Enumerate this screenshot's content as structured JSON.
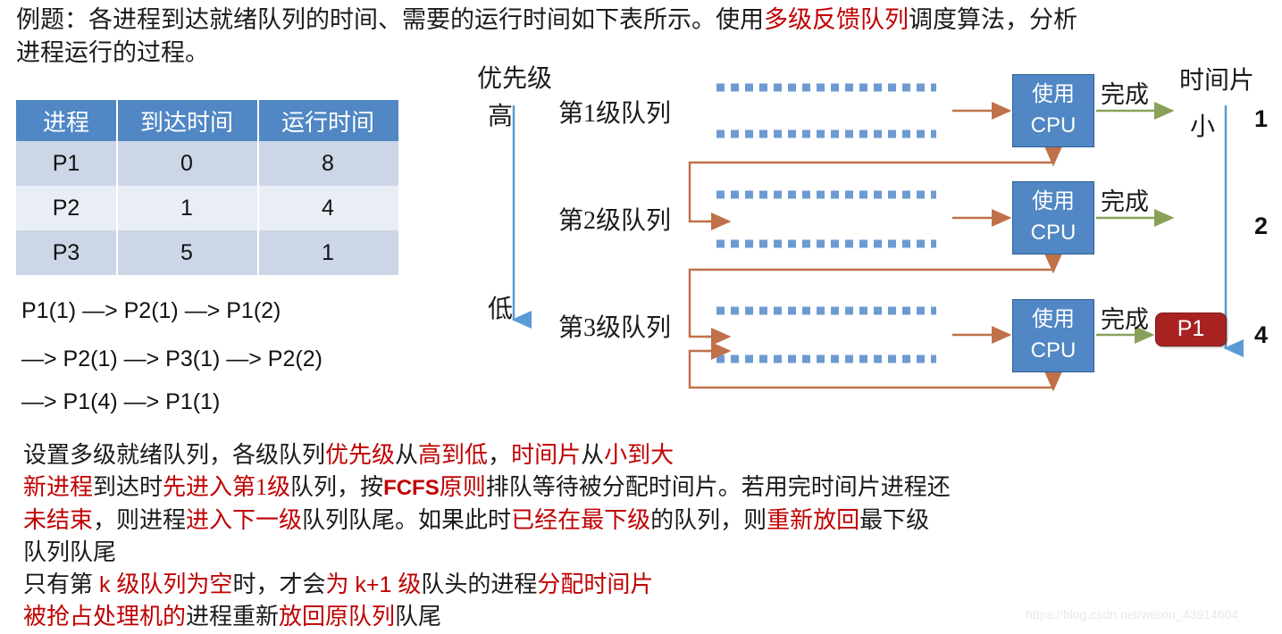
{
  "prompt": {
    "line1_a": "例题：各进程到达就绪队列的时间、需要的运行时间如下表所示。使用",
    "line1_red": "多级反馈队列",
    "line1_b": "调度算法，分析",
    "line2": "进程运行的过程。"
  },
  "table": {
    "headers": [
      "进程",
      "到达时间",
      "运行时间"
    ],
    "rows": [
      [
        "P1",
        "0",
        "8"
      ],
      [
        "P2",
        "1",
        "4"
      ],
      [
        "P3",
        "5",
        "1"
      ]
    ]
  },
  "sequence": {
    "lines": [
      "P1(1) —> P2(1) —> P1(2)",
      "—> P2(1) —> P3(1) —> P2(2)",
      "—> P1(4) —> P1(1)"
    ]
  },
  "diagram": {
    "priority_title": "优先级",
    "priority_high": "高",
    "priority_low": "低",
    "timeslice_title": "时间片",
    "timeslice_small": "小",
    "queues": [
      {
        "label": "第1级队列",
        "cpu_line1": "使用",
        "cpu_line2": "CPU",
        "done": "完成",
        "timeslice": "1"
      },
      {
        "label": "第2级队列",
        "cpu_line1": "使用",
        "cpu_line2": "CPU",
        "done": "完成",
        "timeslice": "2"
      },
      {
        "label": "第3级队列",
        "cpu_line1": "使用",
        "cpu_line2": "CPU",
        "done": "完成",
        "timeslice": "4"
      }
    ],
    "badge": "P1",
    "colors": {
      "cpu_fill": "#5087c4",
      "queue_dots": "#6d9bd1",
      "feedback_arrow": "#c0714a",
      "done_arrow": "#8aa05a",
      "priority_axis": "#5b9bd5",
      "badge_fill": "#a92222"
    }
  },
  "notes": {
    "l1": [
      {
        "t": "设置多级就绪队列，各级队列",
        "c": "k"
      },
      {
        "t": "优先级",
        "c": "r"
      },
      {
        "t": "从",
        "c": "k"
      },
      {
        "t": "高到低",
        "c": "r"
      },
      {
        "t": "，",
        "c": "k"
      },
      {
        "t": "时间片",
        "c": "r"
      },
      {
        "t": "从",
        "c": "k"
      },
      {
        "t": "小到大",
        "c": "r"
      }
    ],
    "l2": [
      {
        "t": "新进程",
        "c": "r"
      },
      {
        "t": "到达时",
        "c": "k"
      },
      {
        "t": "先进入第1级",
        "c": "r"
      },
      {
        "t": "队列，按",
        "c": "k"
      },
      {
        "t": "FCFS",
        "c": "r",
        "f": "sans-b"
      },
      {
        "t": "原则",
        "c": "r"
      },
      {
        "t": "排队等待被分配时间片。若用完时间片进程还",
        "c": "k"
      }
    ],
    "l3": [
      {
        "t": "未结束",
        "c": "r"
      },
      {
        "t": "，则进程",
        "c": "k"
      },
      {
        "t": "进入下一级",
        "c": "r"
      },
      {
        "t": "队列队尾。如果此时",
        "c": "k"
      },
      {
        "t": "已经在最下级",
        "c": "r"
      },
      {
        "t": "的队列，则",
        "c": "k"
      },
      {
        "t": "重新放回",
        "c": "r"
      },
      {
        "t": "最下级",
        "c": "k"
      }
    ],
    "l4": [
      {
        "t": "队列队尾",
        "c": "k"
      }
    ],
    "l5": [
      {
        "t": "只有第",
        "c": "k"
      },
      {
        "t": " k ",
        "c": "r",
        "f": "sans"
      },
      {
        "t": "级队列为空",
        "c": "r"
      },
      {
        "t": "时，才会",
        "c": "k"
      },
      {
        "t": "为",
        "c": "r"
      },
      {
        "t": " k+1 ",
        "c": "r",
        "f": "sans"
      },
      {
        "t": "级",
        "c": "r"
      },
      {
        "t": "队头的进程",
        "c": "k"
      },
      {
        "t": "分配时间片",
        "c": "r"
      }
    ],
    "l6": [
      {
        "t": "被抢占处理机的",
        "c": "r"
      },
      {
        "t": "进程重新",
        "c": "k"
      },
      {
        "t": "放回原队列",
        "c": "r"
      },
      {
        "t": "队尾",
        "c": "k"
      }
    ]
  },
  "watermark": "https://blog.csdn.net/weixin_43914604"
}
